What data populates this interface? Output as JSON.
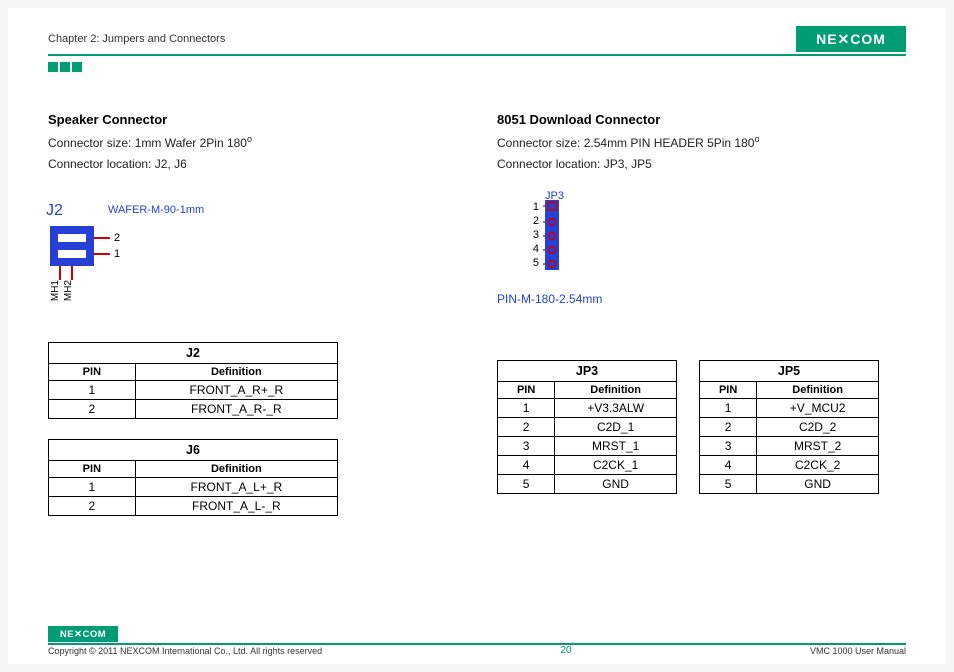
{
  "header": {
    "chapter": "Chapter 2: Jumpers and Connectors",
    "brand": "NE✕COM"
  },
  "left": {
    "title": "Speaker Connector",
    "size_pre": "Connector size: 1mm Wafer 2Pin  180",
    "deg": "o",
    "loc": "Connector location: J2, J6",
    "diag_ref": "J2",
    "part": "WAFER-M-90-1mm",
    "mh1": "MH1",
    "mh2": "MH2",
    "pin1": "1",
    "pin2": "2",
    "tables": [
      {
        "name": "J2",
        "headers": [
          "PIN",
          "Definition"
        ],
        "rows": [
          [
            "1",
            "FRONT_A_R+_R"
          ],
          [
            "2",
            "FRONT_A_R-_R"
          ]
        ]
      },
      {
        "name": "J6",
        "headers": [
          "PIN",
          "Definition"
        ],
        "rows": [
          [
            "1",
            "FRONT_A_L+_R"
          ],
          [
            "2",
            "FRONT_A_L-_R"
          ]
        ]
      }
    ]
  },
  "right": {
    "title": "8051 Download Connector",
    "size_pre": "Connector size: 2.54mm PIN HEADER 5Pin 180",
    "deg": "o",
    "loc": "Connector location: JP3, JP5",
    "diag_ref": "JP3",
    "part": "PIN-M-180-2.54mm",
    "pins": [
      "1",
      "2",
      "3",
      "4",
      "5"
    ],
    "tables": [
      {
        "name": "JP3",
        "headers": [
          "PIN",
          "Definition"
        ],
        "rows": [
          [
            "1",
            "+V3.3ALW"
          ],
          [
            "2",
            "C2D_1"
          ],
          [
            "3",
            "MRST_1"
          ],
          [
            "4",
            "C2CK_1"
          ],
          [
            "5",
            "GND"
          ]
        ]
      },
      {
        "name": "JP5",
        "headers": [
          "PIN",
          "Definition"
        ],
        "rows": [
          [
            "1",
            "+V_MCU2"
          ],
          [
            "2",
            "C2D_2"
          ],
          [
            "3",
            "MRST_2"
          ],
          [
            "4",
            "C2CK_2"
          ],
          [
            "5",
            "GND"
          ]
        ]
      }
    ]
  },
  "footer": {
    "copyright": "Copyright © 2011 NEXCOM International Co., Ltd. All rights reserved",
    "page": "20",
    "manual": "VMC 1000 User Manual",
    "brand": "NE✕COM"
  }
}
